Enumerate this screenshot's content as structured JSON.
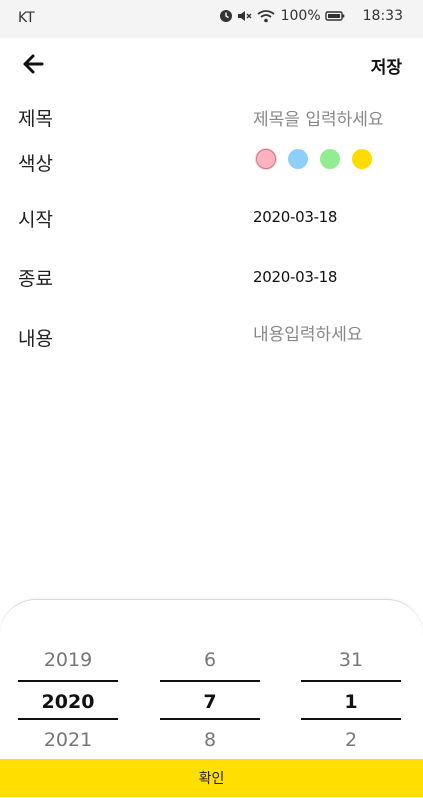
{
  "status_bar": {
    "carrier": "KT",
    "battery": "100%",
    "time": "18:33"
  },
  "header": {
    "back_icon": "arrow-left-icon",
    "save_label": "저장"
  },
  "form": {
    "title_label": "제목",
    "title_placeholder": "제목을 입력하세요",
    "color_label": "색상",
    "colors": [
      "#ffb3c1",
      "#8ecff8",
      "#90ee90",
      "#ffdc00"
    ],
    "selected_color_index": 0,
    "start_label": "시작",
    "start_value": "2020-03-18",
    "end_label": "종료",
    "end_value": "2020-03-18",
    "content_label": "내용",
    "content_placeholder": "내용입력하세요"
  },
  "picker": {
    "year": {
      "prev": "2019",
      "selected": "2020",
      "next": "2021"
    },
    "month": {
      "prev": "6",
      "selected": "7",
      "next": "8"
    },
    "day": {
      "prev": "31",
      "selected": "1",
      "next": "2"
    },
    "confirm_label": "확인"
  }
}
